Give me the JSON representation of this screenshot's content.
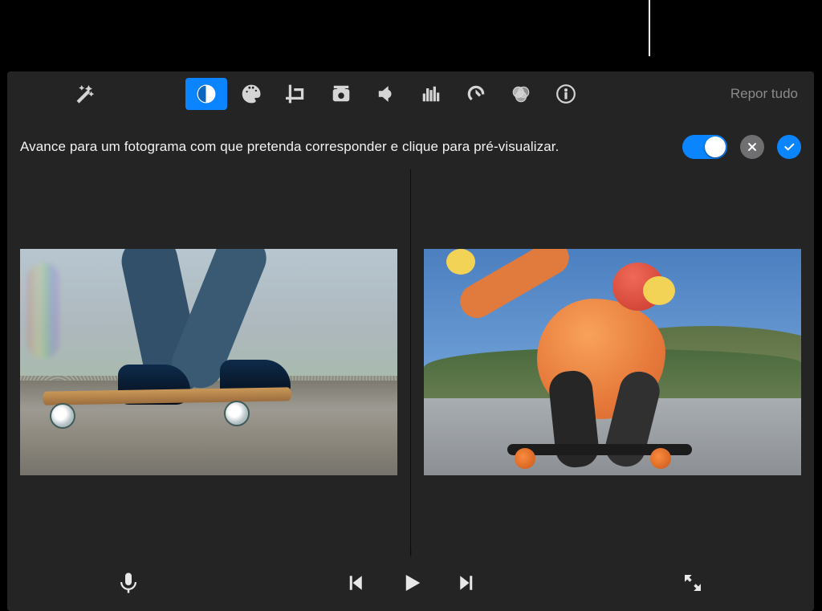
{
  "toolbar": {
    "tools": {
      "wand": "magic-wand",
      "color_balance": "color-balance",
      "color_wheel": "color-correction",
      "crop": "crop",
      "stabilize": "stabilization",
      "volume": "volume",
      "eq": "noise-equalizer",
      "speed": "speed",
      "filters": "filters",
      "info": "info"
    },
    "reset_label": "Repor tudo"
  },
  "subbar": {
    "hint": "Avance para um fotograma com que pretenda corresponder e clique para pré-visualizar.",
    "toggle_on": true,
    "cancel": "cancel",
    "confirm": "confirm"
  },
  "viewer": {
    "left_clip": "Clip A — skateboard close-up",
    "right_clip": "Clip B — skateboarder crouching"
  },
  "controls": {
    "microphone": "voiceover",
    "prev": "previous-frame",
    "play": "play",
    "next": "next-frame",
    "fullscreen": "fullscreen"
  }
}
